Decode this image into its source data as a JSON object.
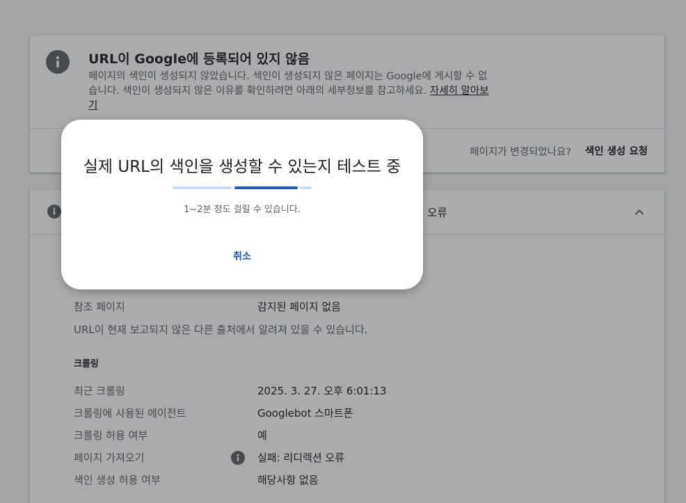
{
  "status_card": {
    "title": "URL이 Google에 등록되어 있지 않음",
    "description": "페이지의 색인이 생성되지 않았습니다. 색인이 생성되지 않은 페이지는 Google에 게시할 수 없습니다. 색인이 생성되지 않은 이유를 확인하려면 아래의 세부정보를 참고하세요.",
    "learn_more": "자세히 알아보기",
    "changed_question": "페이지가 변경되었나요?",
    "request_indexing": "색인 생성 요청"
  },
  "details_card": {
    "header_fragment": "션 오류",
    "rows": [
      {
        "label": "참조 페이지",
        "value": "감지된 페이지 없음"
      }
    ],
    "note": "URL이 현재 보고되지 않은 다른 출처에서 알려져 있을 수 있습니다.",
    "crawl_section": {
      "title": "크롤링",
      "rows": [
        {
          "label": "최근 크롤링",
          "value": "2025. 3. 27. 오후 6:01:13"
        },
        {
          "label": "크롤링에 사용된 에이전트",
          "value": "Googlebot 스마트폰"
        },
        {
          "label": "크롤링 허용 여부",
          "value": "예"
        },
        {
          "label": "페이지 가져오기",
          "value": "실패: 리디렉션 오류"
        },
        {
          "label": "색인 생성 허용 여부",
          "value": "해당사항 없음"
        }
      ]
    }
  },
  "dialog": {
    "title": "실제 URL의 색인을 생성할 수 있는지 테스트 중",
    "subtitle": "1~2분 정도 걸릴 수 있습니다.",
    "cancel": "취소"
  },
  "colors": {
    "accent": "#1a57c7",
    "progress_track": "#c6dafc",
    "icon_grey": "#5f6368"
  }
}
